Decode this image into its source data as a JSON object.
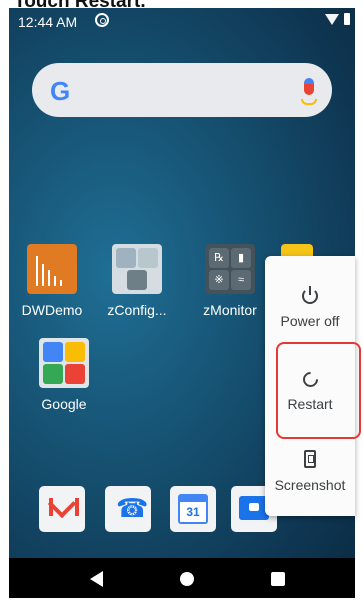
{
  "caption": "Touch Restart.",
  "status_bar": {
    "time": "12:44 AM"
  },
  "home_apps": [
    {
      "label": "DWDemo"
    },
    {
      "label": "zConfig..."
    },
    {
      "label": "zMonitor"
    },
    {
      "label": "Google"
    }
  ],
  "dock": {
    "calendar_day": "31"
  },
  "power_menu": {
    "items": [
      {
        "label": "Power off",
        "icon": "power-icon"
      },
      {
        "label": "Restart",
        "icon": "restart-icon",
        "highlighted": true
      },
      {
        "label": "Screenshot",
        "icon": "screenshot-icon"
      }
    ]
  },
  "colors": {
    "highlight": "#e53935",
    "accent": "#1a73e8"
  }
}
